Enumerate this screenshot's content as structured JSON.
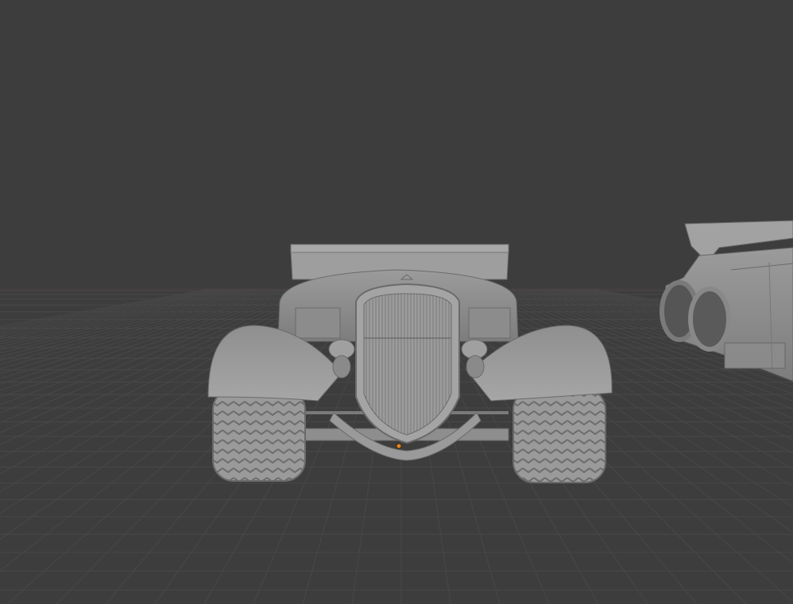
{
  "viewport": {
    "background_color": "#3d3d3d",
    "grid_color": "#484848",
    "horizon_color": "#4a3f3f",
    "origin_marker_color": "#e8851e"
  },
  "scene": {
    "objects": [
      {
        "name": "hot-rod-car",
        "shading": "solid",
        "color": "#9a9a9a"
      },
      {
        "name": "second-car-partial",
        "shading": "solid",
        "color": "#9a9a9a"
      }
    ]
  }
}
